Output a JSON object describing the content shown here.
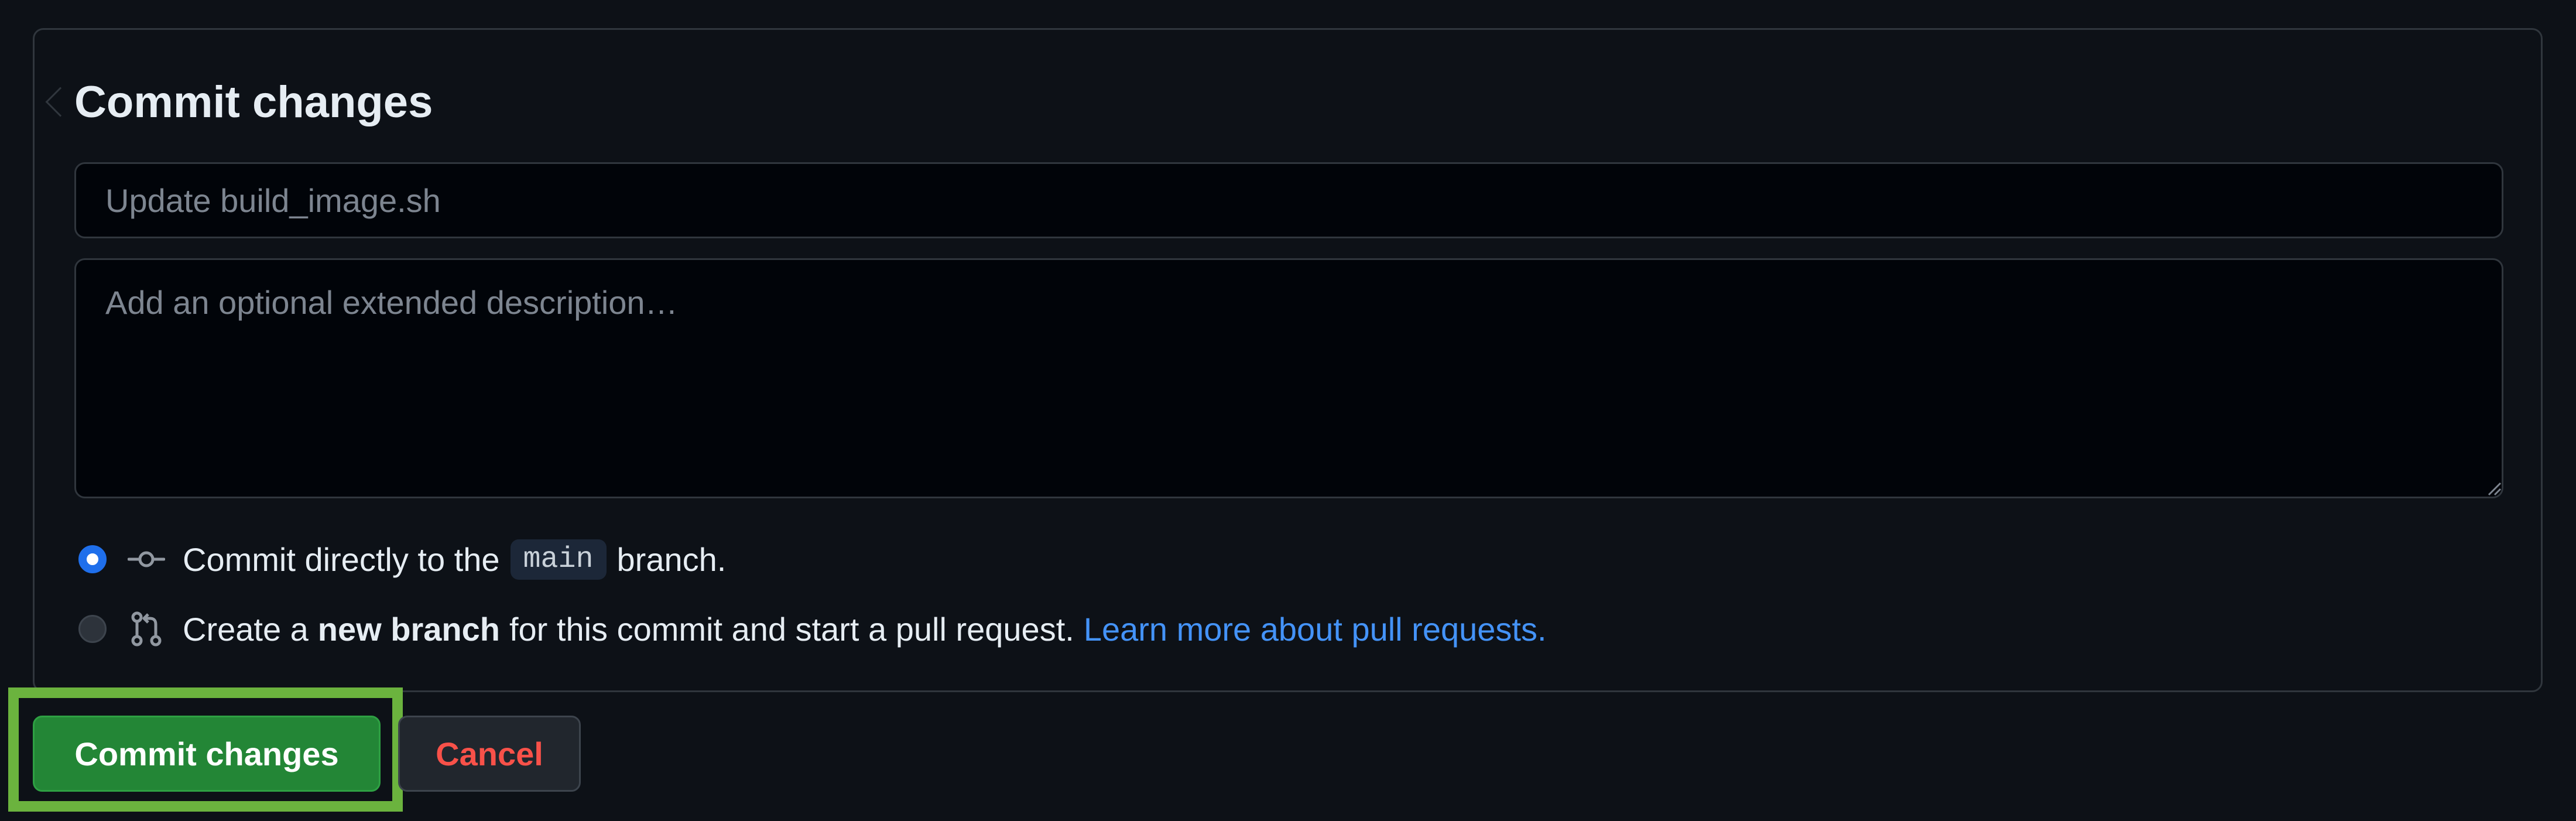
{
  "panel": {
    "title": "Commit changes",
    "summary_placeholder": "Update build_image.sh",
    "description_placeholder": "Add an optional extended description…"
  },
  "options": {
    "direct": {
      "text_before": "Commit directly to the",
      "branch": "main",
      "text_after": "branch.",
      "checked": true,
      "icon": "git-commit-icon"
    },
    "new_branch": {
      "text_before": "Create a",
      "bold": "new branch",
      "text_after": "for this commit and start a pull request.",
      "link": "Learn more about pull requests.",
      "checked": false,
      "icon": "git-pull-request-icon"
    }
  },
  "actions": {
    "commit_label": "Commit changes",
    "cancel_label": "Cancel"
  },
  "colors": {
    "background": "#0d1117",
    "primary": "#238636",
    "danger": "#f85149",
    "link": "#4493f8",
    "radio_checked": "#1f6feb",
    "highlight": "#6bb33e"
  }
}
